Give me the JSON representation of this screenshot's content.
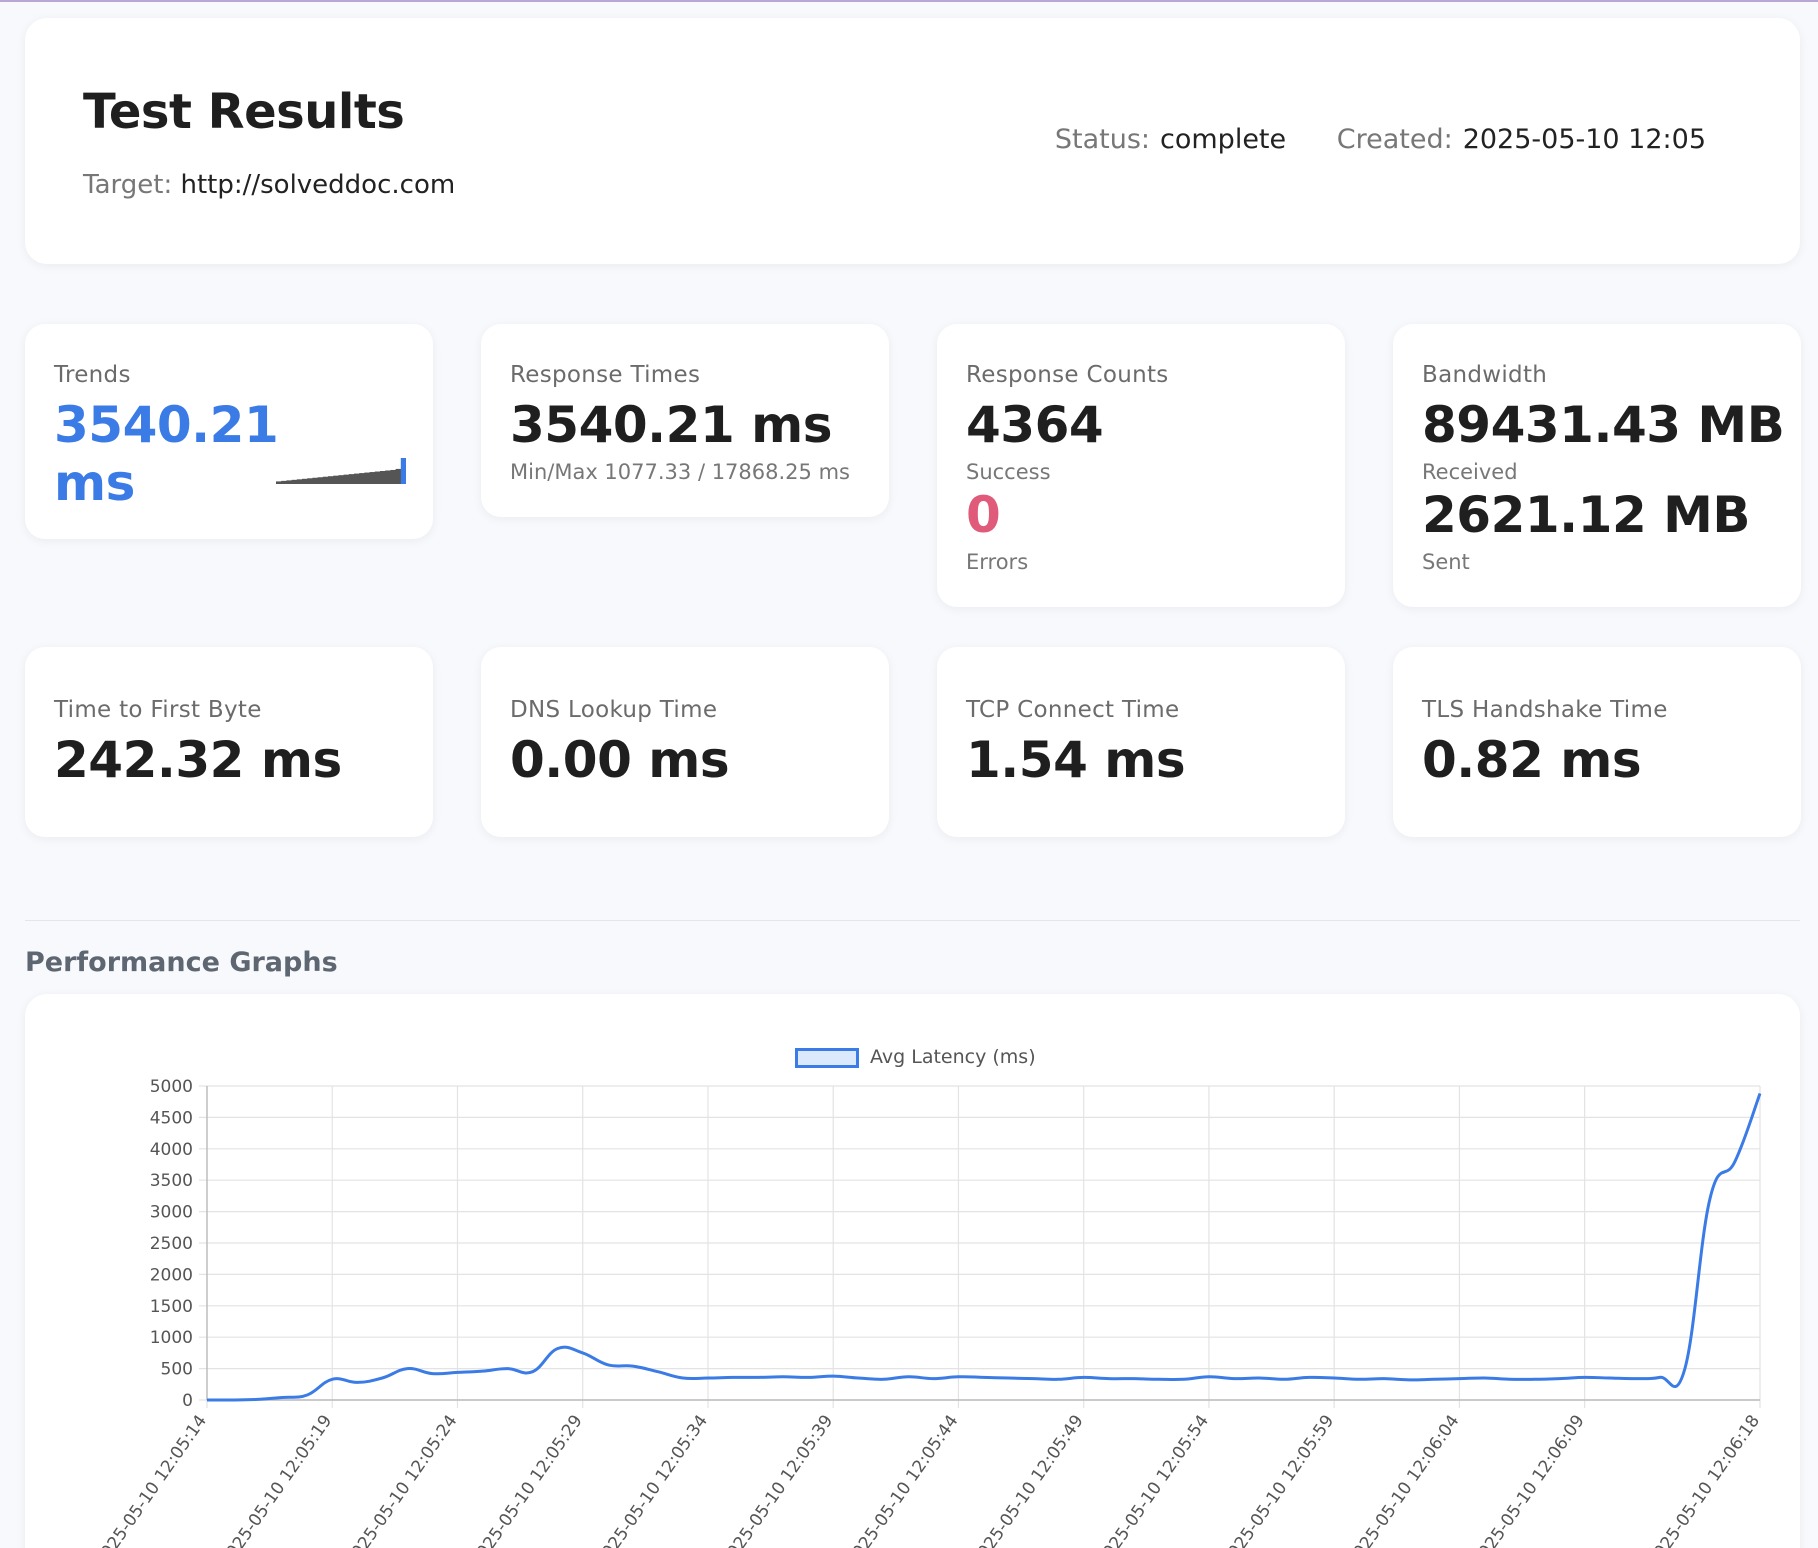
{
  "header": {
    "title": "Test Results",
    "target_label": "Target:",
    "target_value": "http://solveddoc.com",
    "status_label": "Status:",
    "status_value": "complete",
    "created_label": "Created:",
    "created_value": "2025-05-10 12:05"
  },
  "cards": {
    "trends": {
      "title": "Trends",
      "value_num": "3540.21",
      "value_unit": "ms",
      "sparkline": [
        10,
        12,
        14,
        16,
        18,
        20,
        22,
        24,
        26,
        28,
        30,
        32,
        34,
        36,
        38,
        40,
        42,
        44,
        46,
        48,
        50,
        52,
        54,
        58,
        100
      ]
    },
    "response_times": {
      "title": "Response Times",
      "value": "3540.21 ms",
      "minmax": "Min/Max 1077.33 / 17868.25 ms"
    },
    "response_counts": {
      "title": "Response Counts",
      "success_value": "4364",
      "success_label": "Success",
      "errors_value": "0",
      "errors_label": "Errors"
    },
    "bandwidth": {
      "title": "Bandwidth",
      "received_value": "89431.43 MB",
      "received_label": "Received",
      "sent_value": "2621.12 MB",
      "sent_label": "Sent"
    },
    "ttfb": {
      "title": "Time to First Byte",
      "value": "242.32 ms"
    },
    "dns": {
      "title": "DNS Lookup Time",
      "value": "0.00 ms"
    },
    "tcp": {
      "title": "TCP Connect Time",
      "value": "1.54 ms"
    },
    "tls": {
      "title": "TLS Handshake Time",
      "value": "0.82 ms"
    }
  },
  "section": {
    "title": "Performance Graphs"
  },
  "colors": {
    "accent": "#3a7be6",
    "error": "#e05a7a"
  },
  "chart_data": {
    "type": "line",
    "legend": "Avg Latency (ms)",
    "legend_position": "top-center",
    "grid": true,
    "ylim": [
      0,
      5000
    ],
    "yticks": [
      0,
      500,
      1000,
      1500,
      2000,
      2500,
      3000,
      3500,
      4000,
      4500,
      5000
    ],
    "xticks": [
      "2025-05-10 12:05:14",
      "2025-05-10 12:05:19",
      "2025-05-10 12:05:24",
      "2025-05-10 12:05:29",
      "2025-05-10 12:05:34",
      "2025-05-10 12:05:39",
      "2025-05-10 12:05:44",
      "2025-05-10 12:05:49",
      "2025-05-10 12:05:54",
      "2025-05-10 12:05:59",
      "2025-05-10 12:06:04",
      "2025-05-10 12:06:09",
      "2025-05-10 12:06:18"
    ],
    "x": [
      14,
      15,
      16,
      17,
      18,
      19,
      20,
      21,
      22,
      23,
      24,
      25,
      26,
      27,
      28,
      29,
      30,
      31,
      32,
      33,
      34,
      35,
      36,
      37,
      38,
      39,
      40,
      41,
      42,
      43,
      44,
      45,
      46,
      47,
      48,
      49,
      50,
      51,
      52,
      53,
      54,
      55,
      56,
      57,
      58,
      59,
      60,
      61,
      62,
      63,
      64,
      65,
      66,
      67,
      68,
      69,
      70,
      71,
      72,
      73,
      74,
      75,
      76
    ],
    "series": [
      {
        "name": "Avg Latency (ms)",
        "values": [
          0,
          0,
          10,
          40,
          80,
          330,
          280,
          350,
          500,
          420,
          440,
          460,
          500,
          450,
          820,
          750,
          560,
          540,
          450,
          350,
          350,
          360,
          360,
          370,
          360,
          380,
          350,
          330,
          370,
          340,
          370,
          360,
          350,
          340,
          330,
          360,
          340,
          340,
          330,
          330,
          370,
          340,
          350,
          330,
          360,
          350,
          330,
          340,
          320,
          330,
          340,
          350,
          330,
          330,
          340,
          360,
          350,
          340,
          360,
          500,
          3200,
          3800,
          4880
        ]
      }
    ]
  }
}
